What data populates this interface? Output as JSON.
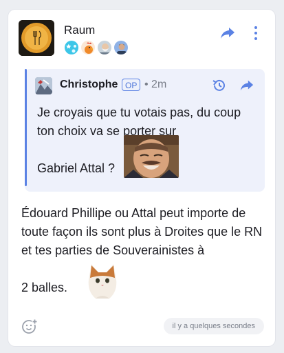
{
  "room": {
    "name": "Raum",
    "avatar_icon": "orange-room-avatar"
  },
  "members": [
    {
      "icon": "stars-avatar-icon"
    },
    {
      "icon": "rooster-avatar-icon"
    },
    {
      "icon": "bearded-man-avatar-icon"
    },
    {
      "icon": "person-avatar-icon"
    }
  ],
  "quote": {
    "author": "Christophe",
    "badge": "OP",
    "timestamp": "• 2m",
    "text_line1": "Je croyais que tu votais pas, du coup ton choix va se porter sur",
    "text_line2": "Gabriel Attal ?",
    "accent_color": "#5b82e4"
  },
  "message": {
    "text_line1": "Édouard Phillipe ou Attal peut importe de toute façon ils sont plus à Droites que le RN et tes parties de Souverainistes à",
    "text_line2": "2 balles."
  },
  "footer": {
    "time_label": "il y a quelques secondes"
  }
}
